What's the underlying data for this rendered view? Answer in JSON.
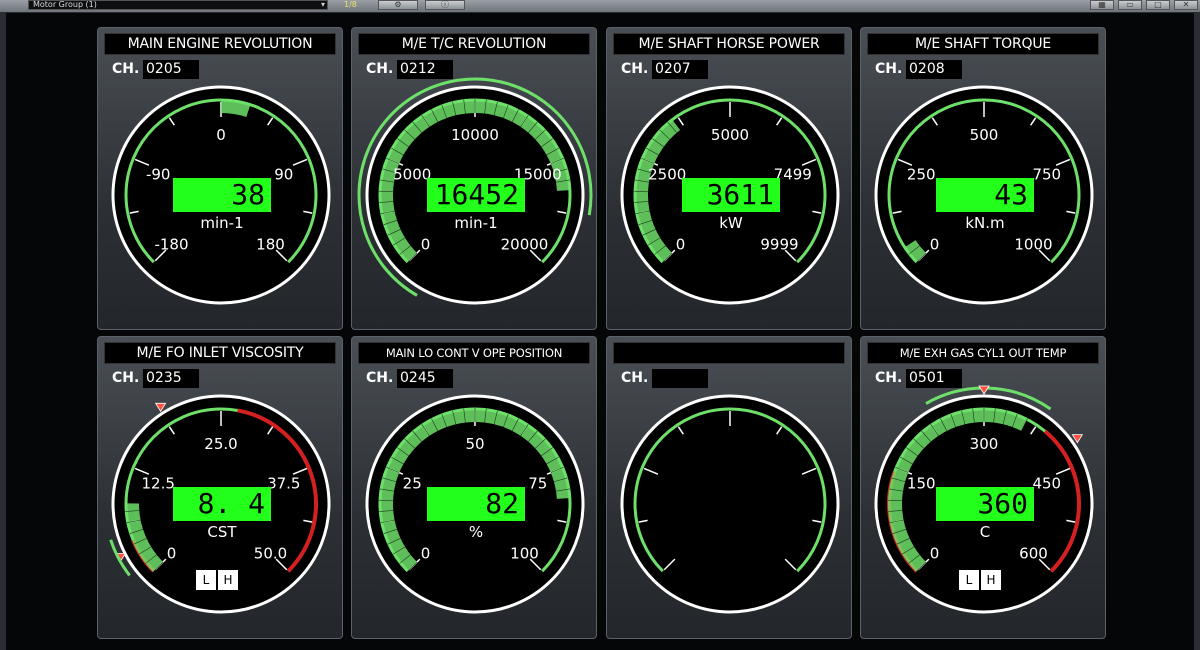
{
  "toolbar": {
    "group_label": "Motor Group (1)",
    "page_indicator": "1/8"
  },
  "colors": {
    "display_green": "#21ff1a",
    "arc_green": "#6ee06a",
    "alarm_red": "#d42020",
    "alarm_marker": "#ff5040"
  },
  "gauges": [
    {
      "title": "MAIN ENGINE REVOLUTION",
      "channel": "0205",
      "value": "38",
      "unit": "min-1",
      "scale_labels": [
        "-180",
        "-90",
        "0",
        "90",
        "180"
      ],
      "range": [
        -180,
        180
      ],
      "indicator": "center-band",
      "has_alarm_buttons": false
    },
    {
      "title": "M/E T/C REVOLUTION",
      "channel": "0212",
      "value": "16452",
      "unit": "min-1",
      "scale_labels": [
        "0",
        "5000",
        "10000",
        "15000",
        "20000"
      ],
      "range": [
        0,
        20000
      ],
      "indicator": "fill",
      "has_alarm_buttons": false
    },
    {
      "title": "M/E SHAFT HORSE POWER",
      "channel": "0207",
      "value": "3611",
      "unit": "kW",
      "scale_labels": [
        "0",
        "2500",
        "5000",
        "7499",
        "9999"
      ],
      "range": [
        0,
        9999
      ],
      "indicator": "fill",
      "has_alarm_buttons": false
    },
    {
      "title": "M/E SHAFT TORQUE",
      "channel": "0208",
      "value": "43",
      "unit": "kN.m",
      "scale_labels": [
        "0",
        "250",
        "500",
        "750",
        "1000"
      ],
      "range": [
        0,
        1000
      ],
      "indicator": "fill",
      "has_alarm_buttons": false
    },
    {
      "title": "M/E FO INLET VISCOSITY",
      "channel": "0235",
      "value": "8. 4",
      "unit": "CST",
      "scale_labels": [
        "0",
        "12.5",
        "25.0",
        "37.5",
        "50.0"
      ],
      "range": [
        0,
        50
      ],
      "indicator": "fill",
      "has_alarm_buttons": true,
      "alarm_buttons": [
        "L",
        "H"
      ]
    },
    {
      "title": "MAIN LO CONT V OPE POSITION",
      "channel": "0245",
      "value": "82",
      "unit": "%",
      "scale_labels": [
        "0",
        "25",
        "50",
        "75",
        "100"
      ],
      "range": [
        0,
        100
      ],
      "indicator": "fill",
      "has_alarm_buttons": false
    },
    {
      "title": "",
      "channel": "",
      "value": "",
      "unit": "",
      "scale_labels": [
        "",
        "",
        "",
        "",
        ""
      ],
      "range": [
        0,
        100
      ],
      "indicator": "none",
      "has_alarm_buttons": false
    },
    {
      "title": "M/E EXH GAS CYL1 OUT TEMP",
      "channel": "0501",
      "value": "360",
      "unit": "C",
      "scale_labels": [
        "0",
        "150",
        "300",
        "450",
        "600"
      ],
      "range": [
        0,
        600
      ],
      "indicator": "fill",
      "has_alarm_buttons": true,
      "alarm_buttons": [
        "L",
        "H"
      ]
    }
  ],
  "ch_prefix": "CH."
}
